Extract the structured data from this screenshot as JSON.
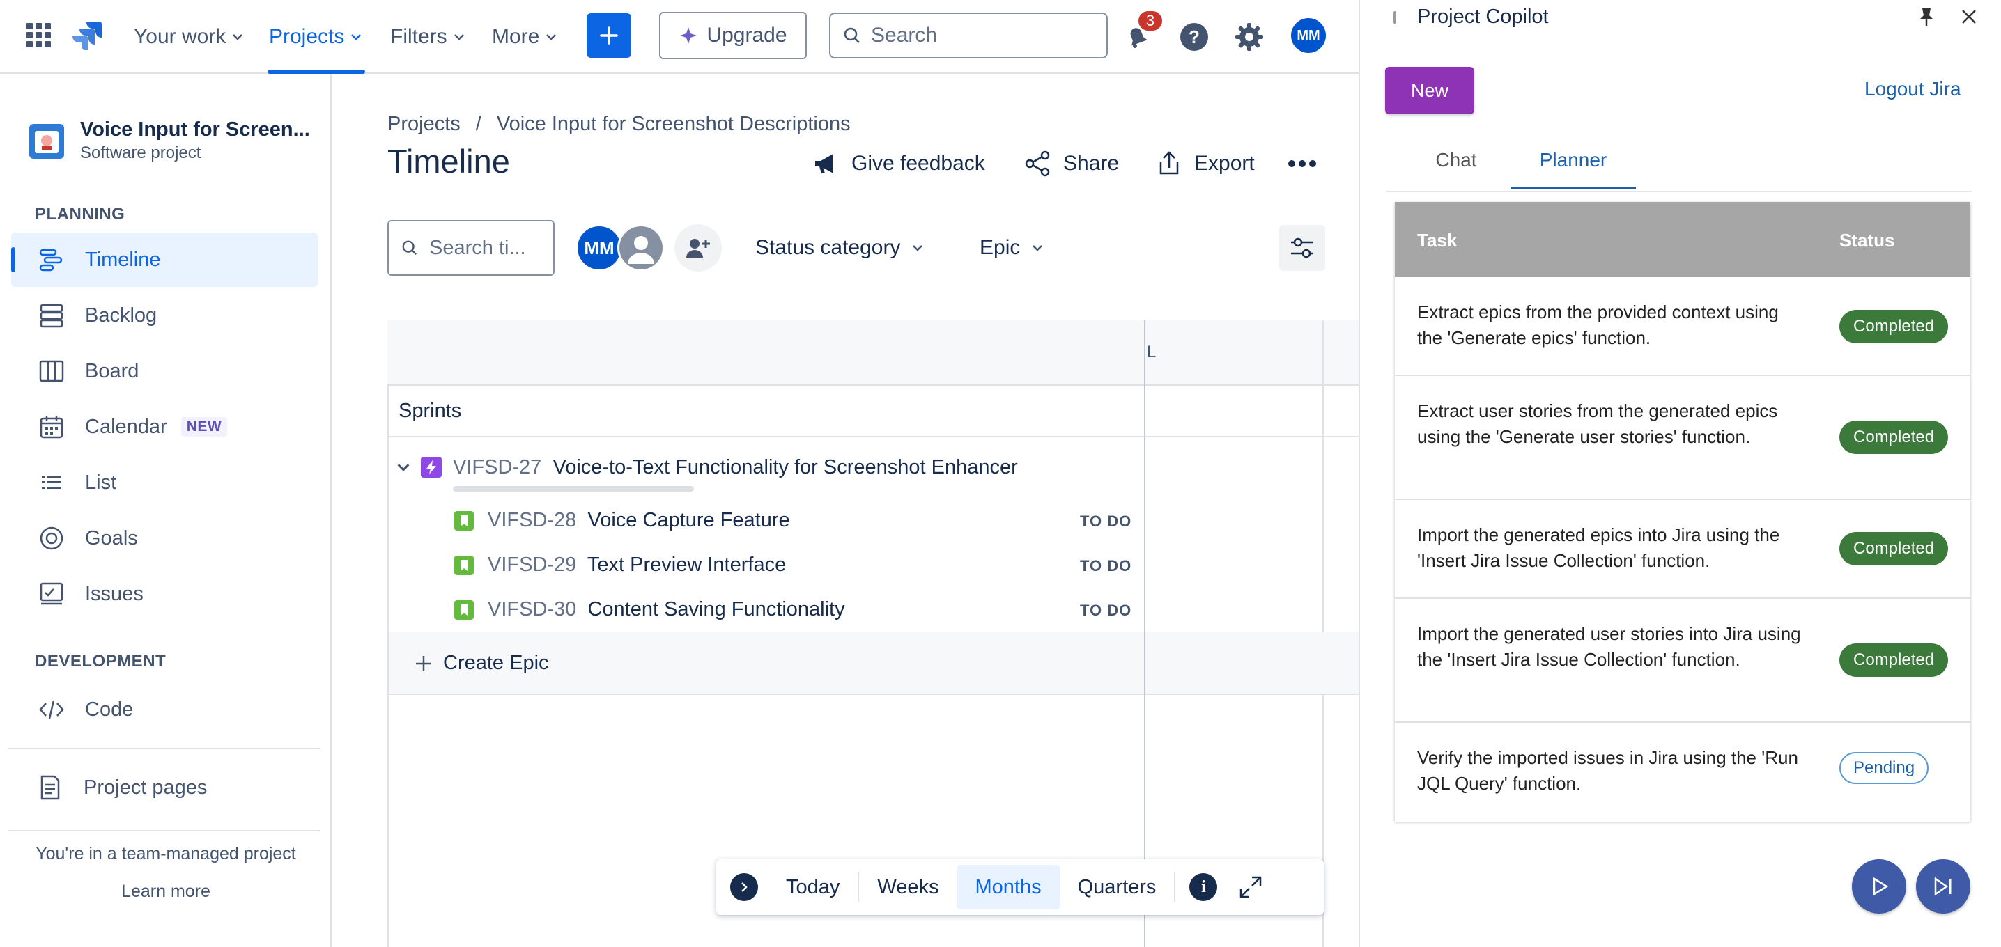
{
  "topnav": {
    "your_work": "Your work",
    "projects": "Projects",
    "filters": "Filters",
    "more": "More",
    "upgrade": "Upgrade",
    "search_placeholder": "Search",
    "notifications_count": "3",
    "avatar_initials": "MM"
  },
  "sidebar": {
    "project_name": "Voice Input for Screen...",
    "project_type": "Software project",
    "planning_header": "PLANNING",
    "items": [
      {
        "label": "Timeline"
      },
      {
        "label": "Backlog"
      },
      {
        "label": "Board"
      },
      {
        "label": "Calendar",
        "badge": "NEW"
      },
      {
        "label": "List"
      },
      {
        "label": "Goals"
      },
      {
        "label": "Issues"
      }
    ],
    "development_header": "DEVELOPMENT",
    "code": "Code",
    "project_pages": "Project pages",
    "team_managed": "You're in a team-managed project",
    "learn_more": "Learn more"
  },
  "main": {
    "breadcrumb": [
      "Projects",
      "/",
      "Voice Input for Screenshot Descriptions"
    ],
    "title": "Timeline",
    "give_feedback": "Give feedback",
    "share": "Share",
    "export": "Export",
    "search_placeholder": "Search ti...",
    "avatar_initials": "MM",
    "status_category": "Status category",
    "epic_filter": "Epic",
    "month_marker": "L",
    "sprints": "Sprints",
    "epic": {
      "key": "VIFSD-27",
      "title": "Voice-to-Text Functionality for Screenshot Enhancer"
    },
    "stories": [
      {
        "key": "VIFSD-28",
        "title": "Voice Capture Feature",
        "status": "TO DO"
      },
      {
        "key": "VIFSD-29",
        "title": "Text Preview Interface",
        "status": "TO DO"
      },
      {
        "key": "VIFSD-30",
        "title": "Content Saving Functionality",
        "status": "TO DO"
      }
    ],
    "create_epic": "Create Epic",
    "toolbar": {
      "today": "Today",
      "weeks": "Weeks",
      "months": "Months",
      "quarters": "Quarters"
    }
  },
  "copilot": {
    "title": "Project Copilot",
    "new_button": "New",
    "logout": "Logout Jira",
    "tabs": [
      "Chat",
      "Planner"
    ],
    "table": {
      "task_header": "Task",
      "status_header": "Status",
      "rows": [
        {
          "task": "Extract epics from the provided context using the 'Generate epics' function.",
          "status": "Completed"
        },
        {
          "task": "Extract user stories from the generated epics using the 'Generate user stories' function.",
          "status": "Completed"
        },
        {
          "task": "Import the generated epics into Jira using the 'Insert Jira Issue Collection' function.",
          "status": "Completed"
        },
        {
          "task": "Import the generated user stories into Jira using the 'Insert Jira Issue Collection' function.",
          "status": "Completed"
        },
        {
          "task": "Verify the imported issues in Jira using the 'Run JQL Query' function.",
          "status": "Pending"
        }
      ]
    },
    "colors": {
      "new_button": "#8e33b5",
      "completed": "#3b7a3b",
      "pending_border": "#5a9bd5",
      "accent": "#1d5fa8"
    }
  }
}
